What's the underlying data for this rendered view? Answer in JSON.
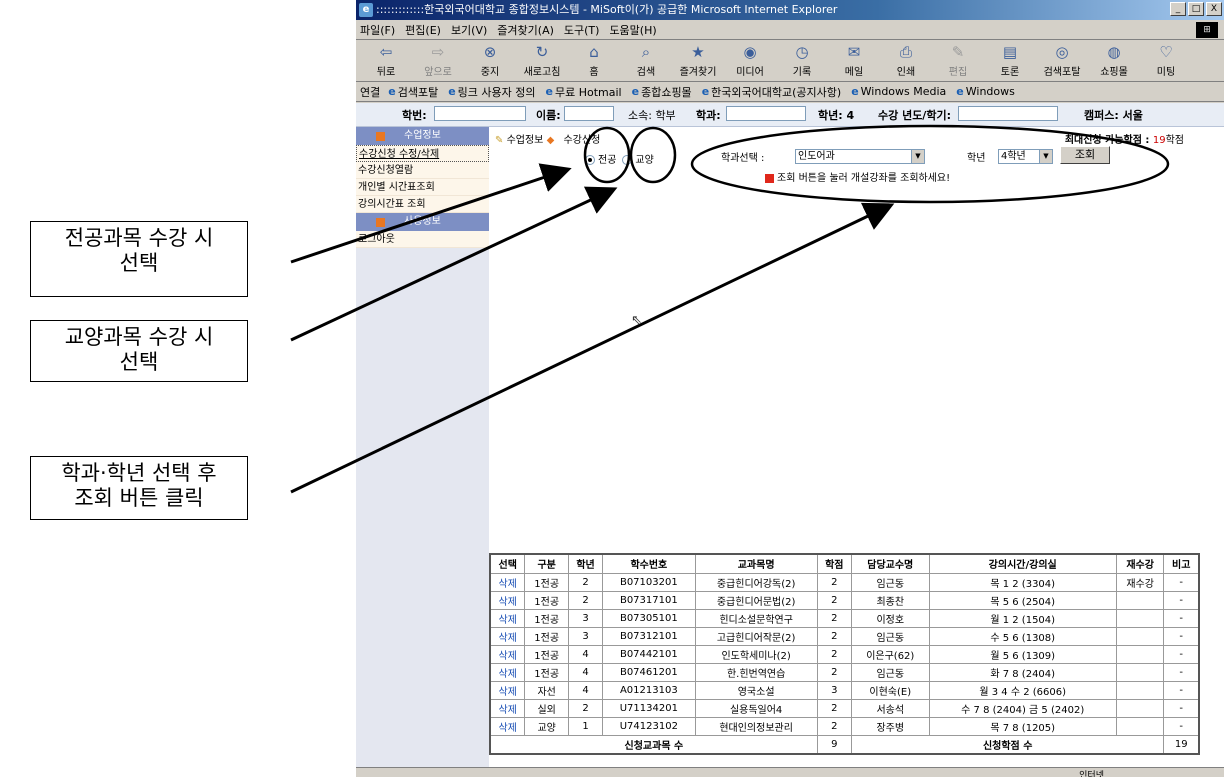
{
  "callouts": {
    "major": {
      "line1": "전공과목 수강 시",
      "line2": "선택"
    },
    "liberal": {
      "line1": "교양과목 수강 시",
      "line2": "선택"
    },
    "search": {
      "line1": "학과·학년 선택 후",
      "line2": "조회 버튼 클릭"
    }
  },
  "window": {
    "title": ":::::::::::::한국외국어대학교 종합정보시스템 - MiSoft이(가) 공급한 Microsoft Internet Explorer",
    "controls": [
      "_",
      "□",
      "X"
    ]
  },
  "menu": [
    "파일(F)",
    "편집(E)",
    "보기(V)",
    "즐겨찾기(A)",
    "도구(T)",
    "도움말(H)"
  ],
  "toolbar": [
    {
      "label": "뒤로",
      "icon": "⇦",
      "disabled": false
    },
    {
      "label": "앞으로",
      "icon": "⇨",
      "disabled": true
    },
    {
      "label": "중지",
      "icon": "⊗",
      "disabled": false
    },
    {
      "label": "새로고침",
      "icon": "↻",
      "disabled": false
    },
    {
      "label": "홈",
      "icon": "⌂",
      "disabled": false
    },
    {
      "label": "검색",
      "icon": "⌕",
      "disabled": false
    },
    {
      "label": "즐겨찾기",
      "icon": "★",
      "disabled": false
    },
    {
      "label": "미디어",
      "icon": "◉",
      "disabled": false
    },
    {
      "label": "기록",
      "icon": "◷",
      "disabled": false
    },
    {
      "label": "메일",
      "icon": "✉",
      "disabled": false
    },
    {
      "label": "인쇄",
      "icon": "⎙",
      "disabled": false
    },
    {
      "label": "편집",
      "icon": "✎",
      "disabled": true
    },
    {
      "label": "토론",
      "icon": "▤",
      "disabled": false
    },
    {
      "label": "검색포탈",
      "icon": "◎",
      "disabled": false
    },
    {
      "label": "쇼핑몰",
      "icon": "◍",
      "disabled": false
    },
    {
      "label": "미팅",
      "icon": "♡",
      "disabled": false
    }
  ],
  "links": {
    "label": "연결",
    "items": [
      "검색포탈",
      "링크 사용자 정의",
      "무료 Hotmail",
      "종합쇼핑몰",
      "한국외국어대학교(공지사항)",
      "Windows Media",
      "Windows"
    ]
  },
  "info": {
    "student_id_label": "학번:",
    "name_label": "이름:",
    "affiliation": "소속: 학부",
    "dept_label": "학과:",
    "year": "학년: 4",
    "term_label": "수강 년도/학기:",
    "campus": "캠퍼스: 서울"
  },
  "sidebar": {
    "section1": "수업정보",
    "items": [
      "수강신청 수정/삭제",
      "수강신청열람",
      "개인별 시간표조회",
      "강의시간표 조회"
    ],
    "section2": "사용정보",
    "logout": "로그아웃"
  },
  "breadcrumb": {
    "part1": "수업정보",
    "part2": "수강신청"
  },
  "credits": {
    "label": "최대신청 가능학점 :",
    "value": "19",
    "unit": "학점"
  },
  "filters": {
    "major_label": "전공",
    "liberal_label": "교양",
    "dept_select_label": "학과선택 :",
    "dept_value": "인도어과",
    "year_label": "학년",
    "year_value": "4학년",
    "search_button": "조회",
    "hint": "조회 버튼을 눌러 개설강좌를 조회하세요!"
  },
  "table": {
    "headers": [
      "선택",
      "구분",
      "학년",
      "학수번호",
      "교과목명",
      "학점",
      "담당교수명",
      "강의시간/강의실",
      "재수강",
      "비고"
    ],
    "rows": [
      [
        "삭제",
        "1전공",
        "2",
        "B07103201",
        "중급힌디어강독(2)",
        "2",
        "임근동",
        "목 1 2 (3304)",
        "재수강",
        "-"
      ],
      [
        "삭제",
        "1전공",
        "2",
        "B07317101",
        "중급힌디어문법(2)",
        "2",
        "최종찬",
        "목 5 6 (2504)",
        "",
        "-"
      ],
      [
        "삭제",
        "1전공",
        "3",
        "B07305101",
        "힌디소설문학연구",
        "2",
        "이정호",
        "월 1 2 (1504)",
        "",
        "-"
      ],
      [
        "삭제",
        "1전공",
        "3",
        "B07312101",
        "고급힌디어작문(2)",
        "2",
        "임근동",
        "수 5 6 (1308)",
        "",
        "-"
      ],
      [
        "삭제",
        "1전공",
        "4",
        "B07442101",
        "인도학세미나(2)",
        "2",
        "이은구(62)",
        "월 5 6 (1309)",
        "",
        "-"
      ],
      [
        "삭제",
        "1전공",
        "4",
        "B07461201",
        "한.힌번역연습",
        "2",
        "임근동",
        "화 7 8 (2404)",
        "",
        "-"
      ],
      [
        "삭제",
        "자선",
        "4",
        "A01213103",
        "영국소설",
        "3",
        "이현숙(E)",
        "월 3 4 수 2 (6606)",
        "",
        "-"
      ],
      [
        "삭제",
        "실외",
        "2",
        "U71134201",
        "실용독일어4",
        "2",
        "서송석",
        "수 7 8 (2404) 금 5 (2402)",
        "",
        "-"
      ],
      [
        "삭제",
        "교양",
        "1",
        "U74123102",
        "현대인의정보관리",
        "2",
        "장주병",
        "목 7 8 (1205)",
        "",
        "-"
      ]
    ],
    "summary": {
      "count_label": "신청교과목 수",
      "count": "9",
      "credits_label": "신청학점 수",
      "credits": "19"
    }
  },
  "status": {
    "zone": "인터넷"
  }
}
